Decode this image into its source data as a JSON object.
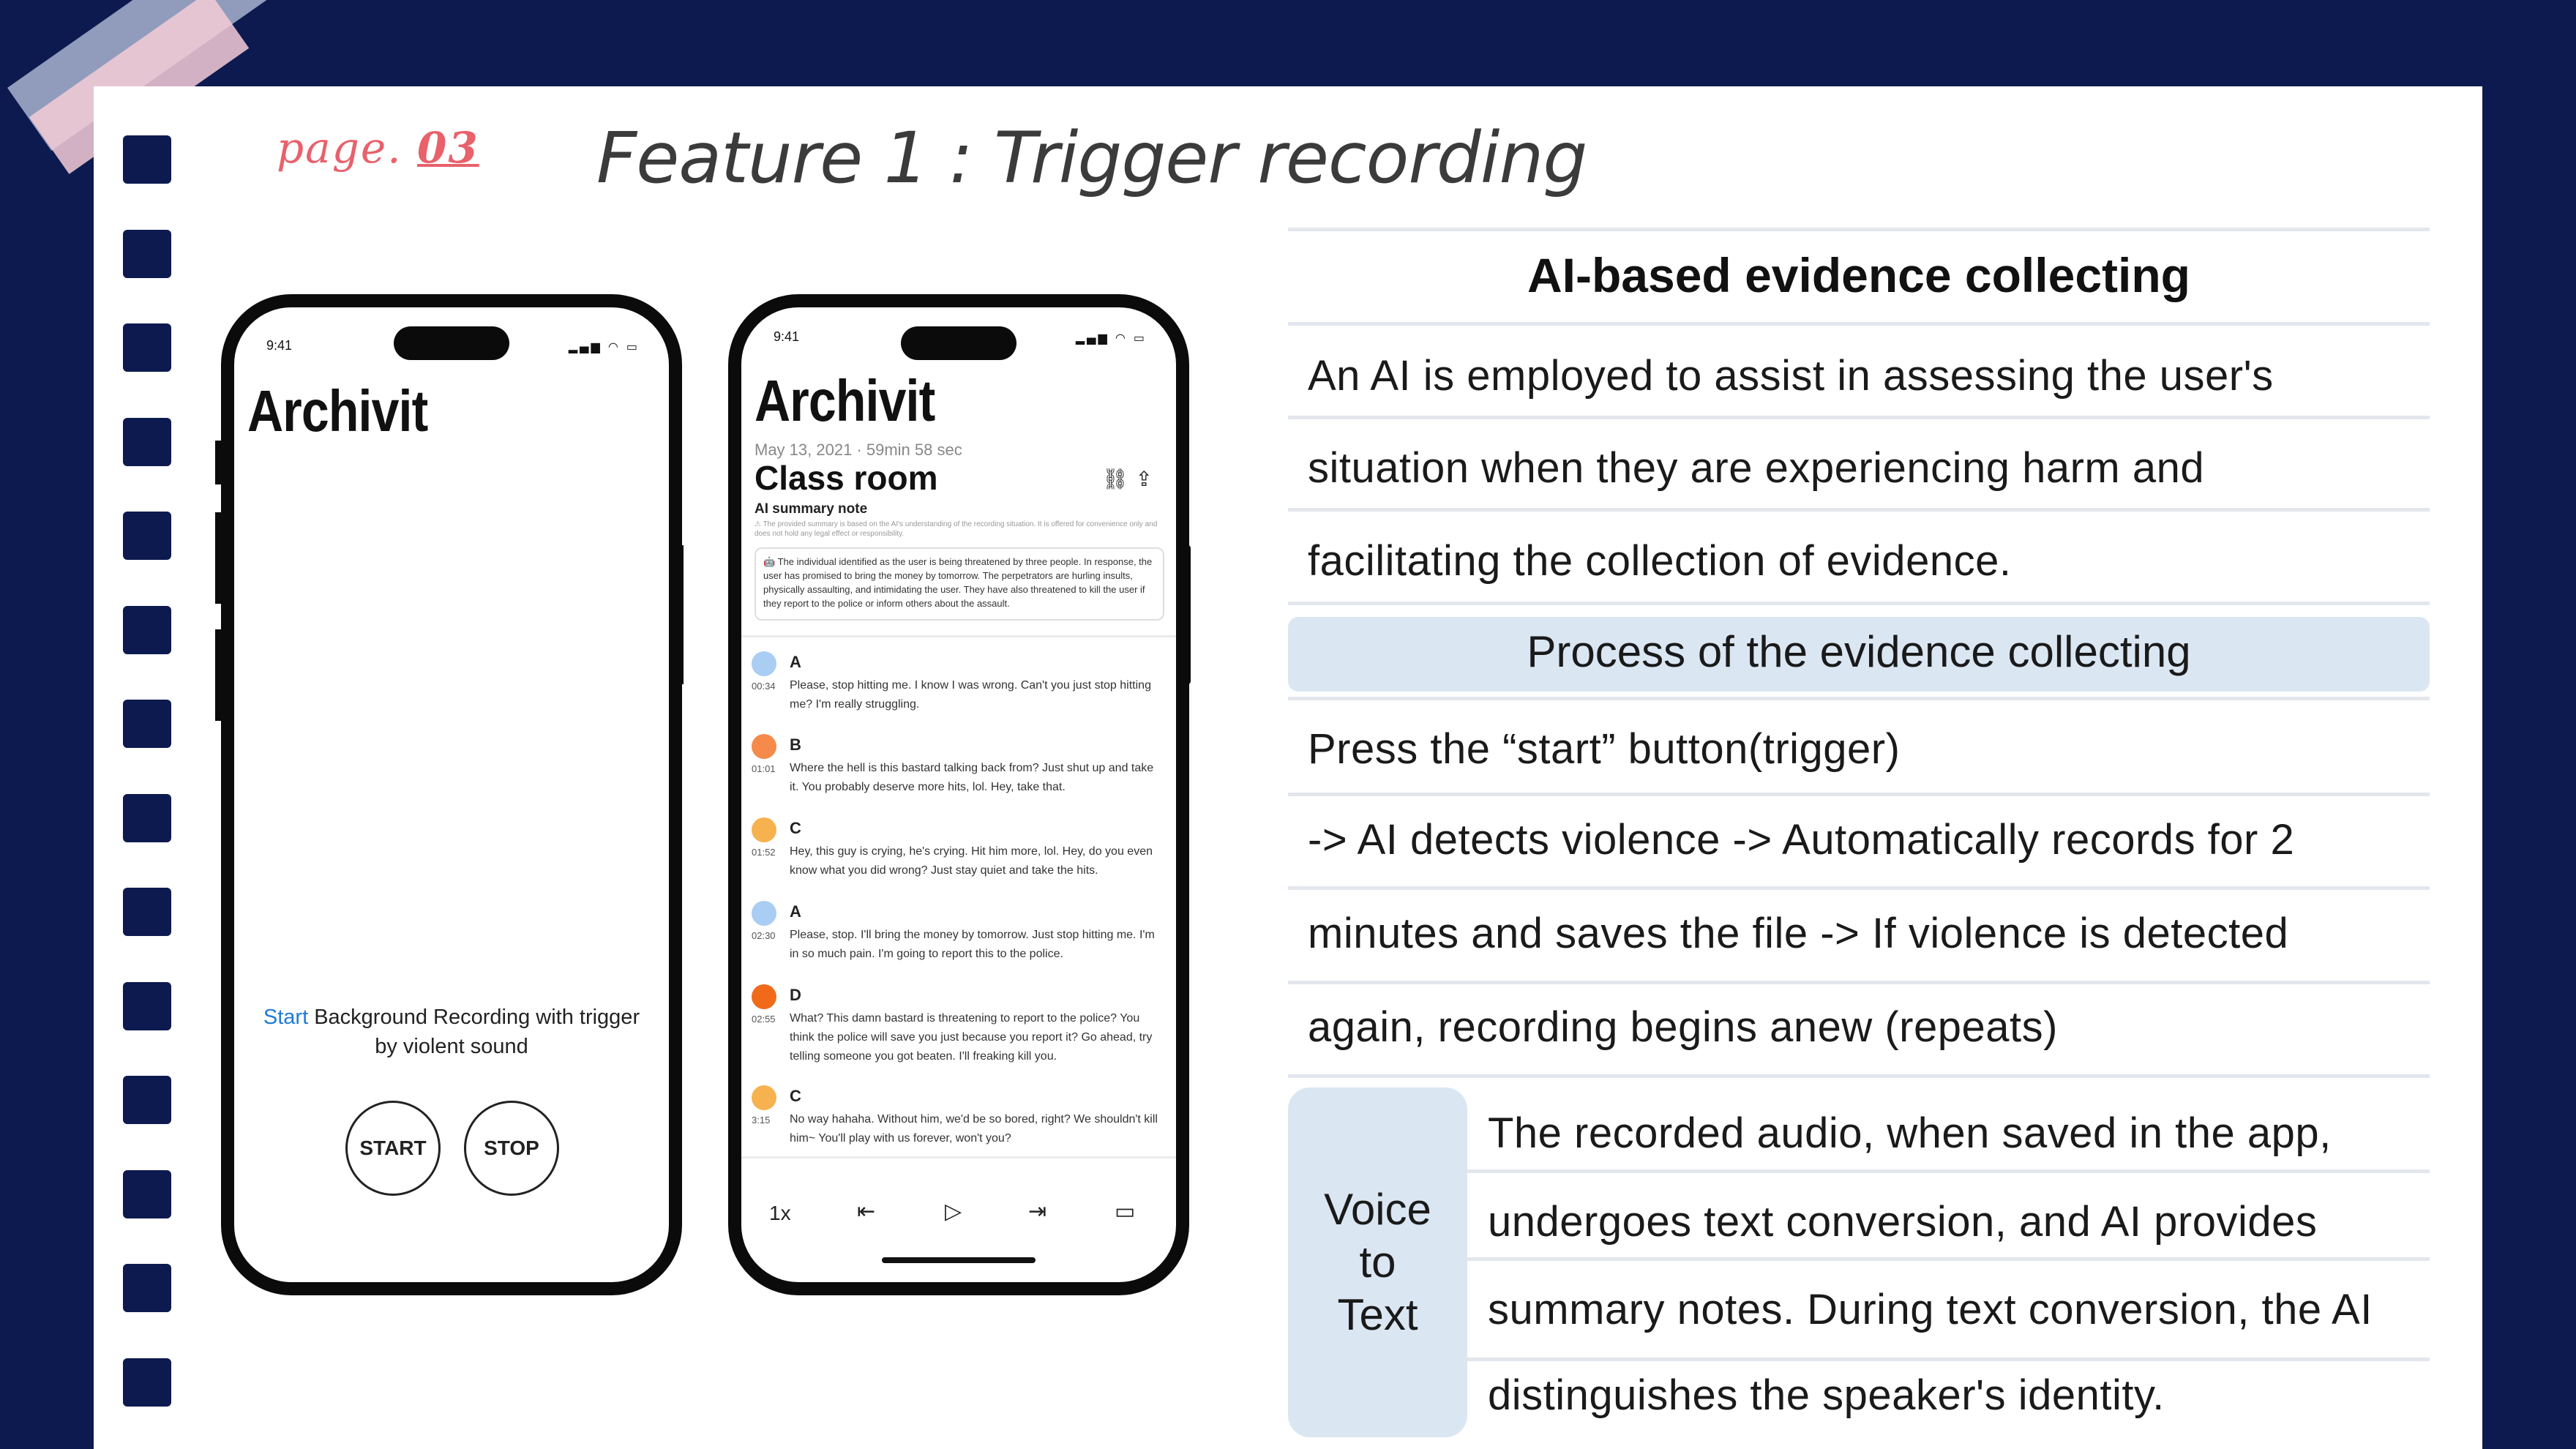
{
  "page_label": {
    "prefix": "page.",
    "number": "03"
  },
  "title": "Feature 1 : Trigger recording",
  "phone1": {
    "time": "9:41",
    "app_name": "Archivit",
    "start_word": "Start",
    "start_rest_line1": " Background Recording with trigger",
    "start_line2": "by violent sound",
    "start_button": "START",
    "stop_button": "STOP"
  },
  "phone2": {
    "time": "9:41",
    "app_name": "Archivit",
    "date_line": "May 13, 2021 · 59min 58 sec",
    "room": "Class room",
    "icons": "⛓ ⇪",
    "summary_title": "AI summary note",
    "disclaimer": "⚠ The provided summary is based on the AI's understanding of the recording situation. It is offered for convenience only and does not hold any legal effect or responsibility.",
    "summary": "🤖 The individual identified as the user is being threatened by three people. In response, the user has promised to bring the money by tomorrow. The perpetrators are hurling insults, physically assaulting, and intimidating the user. They have also threatened to kill the user if they report to the police or inform others about the assault.",
    "transcript": [
      {
        "name": "A",
        "time": "00:34",
        "color": "#a9cdf3",
        "text": "Please, stop hitting me. I know I was wrong. Can't you just stop hitting me? I'm really struggling."
      },
      {
        "name": "B",
        "time": "01:01",
        "color": "#f58a4b",
        "text": "Where the hell is this bastard talking back from? Just shut up and take it. You probably deserve more hits, lol. Hey, take that."
      },
      {
        "name": "C",
        "time": "01:52",
        "color": "#f6b24f",
        "text": "Hey, this guy is crying, he's crying. Hit him more, lol. Hey, do you even know what you did wrong? Just stay quiet and take the hits."
      },
      {
        "name": "A",
        "time": "02:30",
        "color": "#a9cdf3",
        "text": "Please, stop. I'll bring the money by tomorrow. Just stop hitting me. I'm in so much pain. I'm going to report this to the police."
      },
      {
        "name": "D",
        "time": "02:55",
        "color": "#f06a1a",
        "text": "What? This damn bastard is threatening to report to the police? You think the police will save you just because you report it? Go ahead, try telling someone you got beaten. I'll freaking kill you."
      },
      {
        "name": "C",
        "time": "3:15",
        "color": "#f6b24f",
        "text": "No way hahaha. Without him, we'd be so bored, right? We shouldn't kill him~ You'll play with us forever, won't you?"
      }
    ],
    "controls": {
      "speed": "1x",
      "prev": "⇤",
      "play": "▷",
      "next": "⇥",
      "chat": "▭"
    }
  },
  "table": {
    "heading1": "AI-based evidence collecting",
    "intro_lines": [
      "An AI is employed to assist in assessing the user's",
      "situation when they are experiencing harm and",
      "facilitating the collection of evidence."
    ],
    "heading2": "Process of the evidence collecting",
    "process_lines": [
      "Press the “start” button(trigger)",
      "-> AI detects violence -> Automatically records for 2",
      "minutes and saves the file -> If violence is detected",
      "again, recording begins anew (repeats)"
    ],
    "vt_label": "Voice to Text",
    "vt_lines": [
      "The recorded audio, when saved in the app,",
      "undergoes text conversion, and AI provides",
      "summary notes. During text conversion, the AI",
      "distinguishes the speaker's identity."
    ]
  }
}
